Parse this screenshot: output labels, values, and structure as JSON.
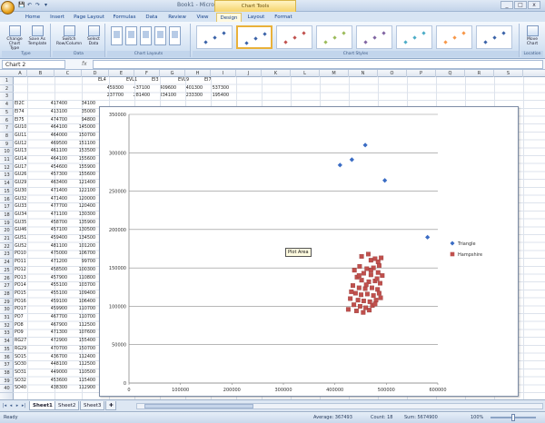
{
  "window": {
    "title": "Book1 - Microsoft Excel",
    "context_tab": "Chart Tools",
    "controls": [
      "_",
      "□",
      "x"
    ]
  },
  "quick_access": [
    "💾",
    "↶",
    "↷",
    "▾"
  ],
  "ribbon_tabs": [
    "Home",
    "Insert",
    "Page Layout",
    "Formulas",
    "Data",
    "Review",
    "View",
    "Design",
    "Layout",
    "Format"
  ],
  "active_tab": "Design",
  "ribbon": {
    "groups": [
      "Type",
      "Data",
      "Chart Layouts",
      "Chart Styles",
      "Location"
    ],
    "buttons": {
      "change_chart_type": "Change Chart Type",
      "save_as_template": "Save As Template",
      "switch_row_column": "Switch Row/Column",
      "select_data": "Select Data",
      "move_chart": "Move Chart"
    },
    "style_colors": [
      "#3a62a8",
      "#3a62a8",
      "#c0504d",
      "#9bbb59",
      "#8064a2",
      "#4bacc6",
      "#f79646",
      "#3a62a8"
    ]
  },
  "formula_bar": {
    "name_box": "Chart 2",
    "fx": "fx",
    "value": ""
  },
  "columns": [
    "A",
    "B",
    "C",
    "D",
    "E",
    "F",
    "G",
    "H",
    "I",
    "J",
    "K",
    "L",
    "M",
    "N",
    "O",
    "P",
    "Q",
    "R",
    "S"
  ],
  "rows": [
    "1",
    "2",
    "3",
    "4",
    "5",
    "6",
    "7",
    "8",
    "9",
    "10",
    "11",
    "12",
    "13",
    "14",
    "15",
    "16",
    "17",
    "18",
    "19",
    "20",
    "21",
    "22",
    "23",
    "24",
    "25",
    "26",
    "27",
    "28",
    "29",
    "30",
    "31",
    "32",
    "33",
    "34",
    "35",
    "36",
    "37",
    "38",
    "39",
    "40"
  ],
  "header_cells": {
    "row1": [
      "EL4",
      "EVL1",
      "EI3",
      "EVL9",
      "EI7"
    ],
    "row2": [
      "459300",
      "437100",
      "409600",
      "401300",
      "537300"
    ],
    "row3": [
      "237700",
      "281400",
      "234100",
      "233300",
      "195400"
    ]
  },
  "data_rows": [
    [
      "EI2C",
      "417400",
      "34100"
    ],
    [
      "EI74",
      "413100",
      "35000"
    ],
    [
      "EI75",
      "474700",
      "94800"
    ],
    [
      "GU10",
      "464100",
      "145000"
    ],
    [
      "GU11",
      "464000",
      "150700"
    ],
    [
      "GU12",
      "469500",
      "151100"
    ],
    [
      "GU13",
      "461100",
      "153500"
    ],
    [
      "GU14",
      "464100",
      "155600"
    ],
    [
      "GU17",
      "454600",
      "155900"
    ],
    [
      "GU26",
      "457300",
      "155600"
    ],
    [
      "GU29",
      "463400",
      "121400"
    ],
    [
      "GU30",
      "471400",
      "122100"
    ],
    [
      "GU32",
      "471400",
      "120000"
    ],
    [
      "GU33",
      "477700",
      "120400"
    ],
    [
      "GU34",
      "471100",
      "130300"
    ],
    [
      "GU35",
      "458700",
      "135900"
    ],
    [
      "GU46",
      "457100",
      "130500"
    ],
    [
      "GU51",
      "459400",
      "134500"
    ],
    [
      "GU52",
      "481100",
      "101200"
    ],
    [
      "PO10",
      "475000",
      "106700"
    ],
    [
      "PO11",
      "471200",
      "99700"
    ],
    [
      "PO12",
      "458500",
      "100300"
    ],
    [
      "PO13",
      "457900",
      "110800"
    ],
    [
      "PO14",
      "455100",
      "103700"
    ],
    [
      "PO15",
      "455100",
      "109400"
    ],
    [
      "PO16",
      "459100",
      "106400"
    ],
    [
      "PO17",
      "459900",
      "110700"
    ],
    [
      "PO7",
      "467700",
      "110700"
    ],
    [
      "PO8",
      "467900",
      "112500"
    ],
    [
      "PO9",
      "471300",
      "107600"
    ],
    [
      "RG27",
      "472900",
      "155400"
    ],
    [
      "RG29",
      "470700",
      "150700"
    ],
    [
      "SO15",
      "436700",
      "112400"
    ],
    [
      "SO30",
      "448100",
      "112500"
    ],
    [
      "SO31",
      "449000",
      "110500"
    ],
    [
      "SO32",
      "453600",
      "115400"
    ],
    [
      "SO40",
      "438300",
      "112900"
    ]
  ],
  "chart_data": {
    "type": "scatter",
    "xlim": [
      0,
      600000
    ],
    "ylim": [
      0,
      350000
    ],
    "x_ticks": [
      "0",
      "100000",
      "200000",
      "300000",
      "400000",
      "500000",
      "600000"
    ],
    "y_ticks": [
      "0",
      "50000",
      "100000",
      "150000",
      "200000",
      "250000",
      "300000",
      "350000"
    ],
    "grid": true,
    "legend_position": "right",
    "series": [
      {
        "name": "Triangle",
        "color": "#3a6cc4",
        "marker": "diamond",
        "points": [
          [
            410000,
            284000
          ],
          [
            433000,
            291000
          ],
          [
            459000,
            310000
          ],
          [
            497000,
            264000
          ],
          [
            580000,
            190000
          ]
        ]
      },
      {
        "name": "Hampshire",
        "color": "#c0504d",
        "marker": "square",
        "points": [
          [
            452000,
            165000
          ],
          [
            465000,
            168000
          ],
          [
            470000,
            160000
          ],
          [
            478000,
            162000
          ],
          [
            484000,
            158000
          ],
          [
            490000,
            163000
          ],
          [
            486000,
            153000
          ],
          [
            475000,
            150000
          ],
          [
            462000,
            149000
          ],
          [
            448000,
            152000
          ],
          [
            438000,
            147000
          ],
          [
            456000,
            143000
          ],
          [
            470000,
            141000
          ],
          [
            484000,
            144000
          ],
          [
            492000,
            140000
          ],
          [
            443000,
            138000
          ],
          [
            452000,
            134000
          ],
          [
            466000,
            132000
          ],
          [
            478000,
            133000
          ],
          [
            488000,
            130000
          ],
          [
            435000,
            127000
          ],
          [
            447000,
            124000
          ],
          [
            459000,
            123000
          ],
          [
            472000,
            124000
          ],
          [
            483000,
            122000
          ],
          [
            440000,
            117000
          ],
          [
            451000,
            115000
          ],
          [
            463000,
            116000
          ],
          [
            475000,
            114000
          ],
          [
            486000,
            117000
          ],
          [
            430000,
            110000
          ],
          [
            445000,
            108000
          ],
          [
            456000,
            107000
          ],
          [
            468000,
            106000
          ],
          [
            480000,
            108000
          ],
          [
            437000,
            102000
          ],
          [
            449000,
            100000
          ],
          [
            460000,
            98000
          ],
          [
            473000,
            101000
          ],
          [
            426000,
            96000
          ],
          [
            442000,
            94000
          ],
          [
            455000,
            92000
          ],
          [
            467000,
            95000
          ],
          [
            478000,
            103000
          ],
          [
            489000,
            111000
          ],
          [
            432000,
            119000
          ],
          [
            461000,
            128000
          ],
          [
            447000,
            140000
          ],
          [
            470000,
            147000
          ],
          [
            482000,
            136000
          ]
        ]
      }
    ],
    "tooltip": "Plot Area"
  },
  "sheet_tabs": [
    "Sheet1",
    "Sheet2",
    "Sheet3"
  ],
  "active_sheet": "Sheet1",
  "status": {
    "ready": "Ready",
    "average": "Average: 367493",
    "count": "Count: 18",
    "sum": "Sum: 5674900",
    "zoom": "100%"
  }
}
